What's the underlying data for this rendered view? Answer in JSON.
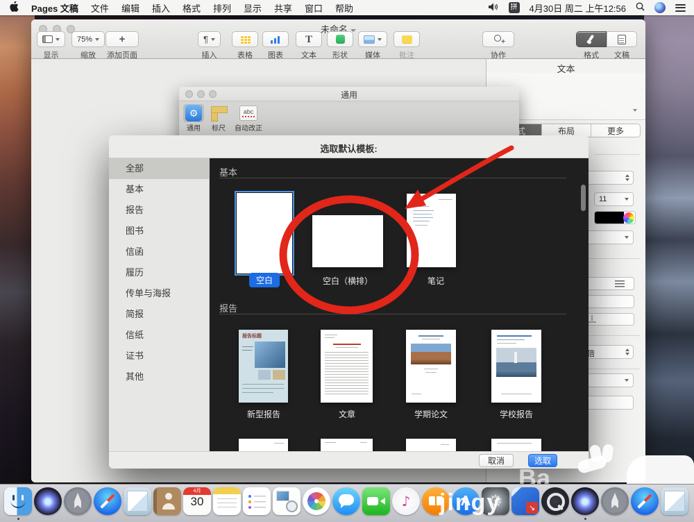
{
  "menu_bar": {
    "items": [
      "Pages 文稿",
      "文件",
      "编辑",
      "插入",
      "格式",
      "排列",
      "显示",
      "共享",
      "窗口",
      "帮助"
    ],
    "input_method": "拼",
    "datetime": "4月30日 周二 上午12:56"
  },
  "pages_window": {
    "title": "未命名",
    "toolbar": {
      "view": "显示",
      "zoom": "缩放",
      "zoom_value": "75%",
      "add_page": "添加页面",
      "insert": "插入",
      "insert_glyph": "¶",
      "table": "表格",
      "chart": "图表",
      "text": "文本",
      "shape": "形状",
      "media": "媒体",
      "comment": "批注",
      "collaborate": "协作",
      "format": "格式",
      "document": "文稿"
    },
    "format_panel": {
      "header": "文本",
      "tabs": [
        "样式",
        "布局",
        "更多"
      ],
      "font_size": "11",
      "spacing_unit": "倍"
    }
  },
  "preferences_window": {
    "title": "通用",
    "toolbar": [
      {
        "label": "通用"
      },
      {
        "label": "标尺"
      },
      {
        "label": "自动改正"
      }
    ],
    "autocorrect_glyph": "abc"
  },
  "template_dialog": {
    "title": "选取默认模板:",
    "sidebar": [
      "全部",
      "基本",
      "报告",
      "图书",
      "信函",
      "履历",
      "传单与海报",
      "简报",
      "信纸",
      "证书",
      "其他"
    ],
    "section_basic": "基本",
    "section_report": "报告",
    "templates": {
      "blank": "空白",
      "blank_landscape": "空白（横排）",
      "note": "笔记",
      "modern_report": "新型报告",
      "essay": "文章",
      "term_paper": "学期论文",
      "school_report": "学校报告"
    },
    "report_thumb_title": "报告标题",
    "cancel": "取消",
    "choose": "选取"
  },
  "dock": {
    "icons": [
      "finder",
      "siri",
      "launchpad",
      "safari",
      "mail",
      "contacts",
      "calendar",
      "notes",
      "reminders",
      "photo-booth",
      "photos",
      "messages",
      "facetime",
      "itunes",
      "ibooks",
      "app-store",
      "system-preferences",
      "downloads",
      "quicktime",
      "siri",
      "launchpad",
      "safari",
      "mail"
    ],
    "calendar_month": "4月",
    "calendar_day": "30"
  },
  "watermark": {
    "text_top": "Ba",
    "text_bottom": "jingy"
  },
  "colors": {
    "accent_blue": "#2271e0",
    "annotation_red": "#e2261a",
    "selected_label_blue": "#1c6ce3"
  }
}
